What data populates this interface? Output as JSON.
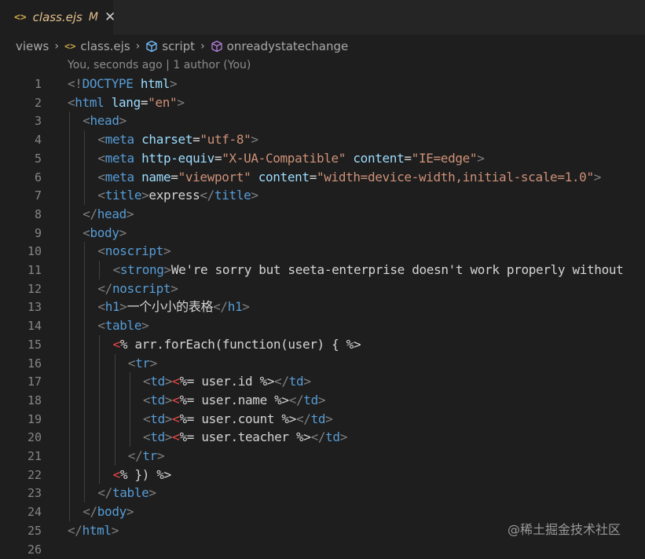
{
  "tab": {
    "icon": "ejs-file-icon",
    "icon_text": "<>",
    "filename": "class.ejs",
    "status": "M",
    "close_glyph": "✕"
  },
  "breadcrumb": {
    "items": [
      {
        "label": "views",
        "icon": null
      },
      {
        "label": "class.ejs",
        "icon": "ejs-file-icon",
        "icon_text": "<>"
      },
      {
        "label": "script",
        "icon": "cube-icon"
      },
      {
        "label": "onreadystatechange",
        "icon": "method-icon"
      }
    ],
    "separator": "›"
  },
  "blame": "You, seconds ago | 1 author (You)",
  "colors": {
    "background": "#1e1e1e",
    "tag": "#569cd6",
    "attribute": "#9cdcfe",
    "string": "#ce9178",
    "punctuation": "#808080",
    "text": "#d4d4d4",
    "ejs_delimiter": "#f44747",
    "modified": "#e2c08d"
  },
  "code_lines": [
    {
      "n": "1",
      "indent": 0,
      "tokens": [
        [
          "punct",
          "<!"
        ],
        [
          "tag",
          "DOCTYPE"
        ],
        [
          "text",
          " "
        ],
        [
          "attr",
          "html"
        ],
        [
          "punct",
          ">"
        ]
      ]
    },
    {
      "n": "2",
      "indent": 0,
      "tokens": [
        [
          "punct",
          "<"
        ],
        [
          "tag",
          "html"
        ],
        [
          "text",
          " "
        ],
        [
          "attr",
          "lang"
        ],
        [
          "text",
          "="
        ],
        [
          "str",
          "\"en\""
        ],
        [
          "punct",
          ">"
        ]
      ]
    },
    {
      "n": "3",
      "indent": 1,
      "tokens": [
        [
          "punct",
          "<"
        ],
        [
          "tag",
          "head"
        ],
        [
          "punct",
          ">"
        ]
      ]
    },
    {
      "n": "4",
      "indent": 2,
      "tokens": [
        [
          "punct",
          "<"
        ],
        [
          "tag",
          "meta"
        ],
        [
          "text",
          " "
        ],
        [
          "attr",
          "charset"
        ],
        [
          "text",
          "="
        ],
        [
          "str",
          "\"utf-8\""
        ],
        [
          "punct",
          ">"
        ]
      ]
    },
    {
      "n": "5",
      "indent": 2,
      "tokens": [
        [
          "punct",
          "<"
        ],
        [
          "tag",
          "meta"
        ],
        [
          "text",
          " "
        ],
        [
          "attr",
          "http-equiv"
        ],
        [
          "text",
          "="
        ],
        [
          "str",
          "\"X-UA-Compatible\""
        ],
        [
          "text",
          " "
        ],
        [
          "attr",
          "content"
        ],
        [
          "text",
          "="
        ],
        [
          "str",
          "\"IE=edge\""
        ],
        [
          "punct",
          ">"
        ]
      ]
    },
    {
      "n": "6",
      "indent": 2,
      "tokens": [
        [
          "punct",
          "<"
        ],
        [
          "tag",
          "meta"
        ],
        [
          "text",
          " "
        ],
        [
          "attr",
          "name"
        ],
        [
          "text",
          "="
        ],
        [
          "str",
          "\"viewport\""
        ],
        [
          "text",
          " "
        ],
        [
          "attr",
          "content"
        ],
        [
          "text",
          "="
        ],
        [
          "str",
          "\"width=device-width,initial-scale=1.0\""
        ],
        [
          "punct",
          ">"
        ]
      ]
    },
    {
      "n": "7",
      "indent": 2,
      "tokens": [
        [
          "punct",
          "<"
        ],
        [
          "tag",
          "title"
        ],
        [
          "punct",
          ">"
        ],
        [
          "text",
          "express"
        ],
        [
          "punct",
          "</"
        ],
        [
          "tag",
          "title"
        ],
        [
          "punct",
          ">"
        ]
      ]
    },
    {
      "n": "8",
      "indent": 1,
      "tokens": [
        [
          "punct",
          "</"
        ],
        [
          "tag",
          "head"
        ],
        [
          "punct",
          ">"
        ]
      ]
    },
    {
      "n": "9",
      "indent": 1,
      "tokens": [
        [
          "punct",
          "<"
        ],
        [
          "tag",
          "body"
        ],
        [
          "punct",
          ">"
        ]
      ]
    },
    {
      "n": "10",
      "indent": 2,
      "tokens": [
        [
          "punct",
          "<"
        ],
        [
          "tag",
          "noscript"
        ],
        [
          "punct",
          ">"
        ]
      ]
    },
    {
      "n": "11",
      "indent": 3,
      "tokens": [
        [
          "punct",
          "<"
        ],
        [
          "tag",
          "strong"
        ],
        [
          "punct",
          ">"
        ],
        [
          "text",
          "We're sorry but seeta-enterprise doesn't work properly without"
        ]
      ]
    },
    {
      "n": "12",
      "indent": 2,
      "tokens": [
        [
          "punct",
          "</"
        ],
        [
          "tag",
          "noscript"
        ],
        [
          "punct",
          ">"
        ]
      ]
    },
    {
      "n": "13",
      "indent": 2,
      "tokens": [
        [
          "punct",
          "<"
        ],
        [
          "tag",
          "h1"
        ],
        [
          "punct",
          ">"
        ],
        [
          "text",
          "一个小小的表格"
        ],
        [
          "punct",
          "</"
        ],
        [
          "tag",
          "h1"
        ],
        [
          "punct",
          ">"
        ]
      ]
    },
    {
      "n": "14",
      "indent": 2,
      "tokens": [
        [
          "punct",
          "<"
        ],
        [
          "tag",
          "table"
        ],
        [
          "punct",
          ">"
        ]
      ]
    },
    {
      "n": "15",
      "indent": 3,
      "tokens": [
        [
          "ejs",
          "<"
        ],
        [
          "js",
          "% arr.forEach(function(user) { %>"
        ]
      ]
    },
    {
      "n": "16",
      "indent": 4,
      "tokens": [
        [
          "punct",
          "<"
        ],
        [
          "tag",
          "tr"
        ],
        [
          "punct",
          ">"
        ]
      ]
    },
    {
      "n": "17",
      "indent": 5,
      "tokens": [
        [
          "punct",
          "<"
        ],
        [
          "tag",
          "td"
        ],
        [
          "punct",
          ">"
        ],
        [
          "ejs",
          "<"
        ],
        [
          "js",
          "%= user.id %>"
        ],
        [
          "punct",
          "</"
        ],
        [
          "tag",
          "td"
        ],
        [
          "punct",
          ">"
        ]
      ]
    },
    {
      "n": "18",
      "indent": 5,
      "tokens": [
        [
          "punct",
          "<"
        ],
        [
          "tag",
          "td"
        ],
        [
          "punct",
          ">"
        ],
        [
          "ejs",
          "<"
        ],
        [
          "js",
          "%= user.name %>"
        ],
        [
          "punct",
          "</"
        ],
        [
          "tag",
          "td"
        ],
        [
          "punct",
          ">"
        ]
      ]
    },
    {
      "n": "19",
      "indent": 5,
      "tokens": [
        [
          "punct",
          "<"
        ],
        [
          "tag",
          "td"
        ],
        [
          "punct",
          ">"
        ],
        [
          "ejs",
          "<"
        ],
        [
          "js",
          "%= user.count %>"
        ],
        [
          "punct",
          "</"
        ],
        [
          "tag",
          "td"
        ],
        [
          "punct",
          ">"
        ]
      ]
    },
    {
      "n": "20",
      "indent": 5,
      "tokens": [
        [
          "punct",
          "<"
        ],
        [
          "tag",
          "td"
        ],
        [
          "punct",
          ">"
        ],
        [
          "ejs",
          "<"
        ],
        [
          "js",
          "%= user.teacher %>"
        ],
        [
          "punct",
          "</"
        ],
        [
          "tag",
          "td"
        ],
        [
          "punct",
          ">"
        ]
      ]
    },
    {
      "n": "21",
      "indent": 4,
      "tokens": [
        [
          "punct",
          "</"
        ],
        [
          "tag",
          "tr"
        ],
        [
          "punct",
          ">"
        ]
      ]
    },
    {
      "n": "22",
      "indent": 3,
      "tokens": [
        [
          "ejs",
          "<"
        ],
        [
          "js",
          "% }) %>"
        ]
      ]
    },
    {
      "n": "23",
      "indent": 2,
      "tokens": [
        [
          "punct",
          "</"
        ],
        [
          "tag",
          "table"
        ],
        [
          "punct",
          ">"
        ]
      ]
    },
    {
      "n": "24",
      "indent": 1,
      "tokens": [
        [
          "punct",
          "</"
        ],
        [
          "tag",
          "body"
        ],
        [
          "punct",
          ">"
        ]
      ]
    },
    {
      "n": "25",
      "indent": 0,
      "tokens": [
        [
          "punct",
          "</"
        ],
        [
          "tag",
          "html"
        ],
        [
          "punct",
          ">"
        ]
      ]
    },
    {
      "n": "26",
      "indent": 0,
      "tokens": []
    }
  ],
  "watermark": "@稀土掘金技术社区"
}
